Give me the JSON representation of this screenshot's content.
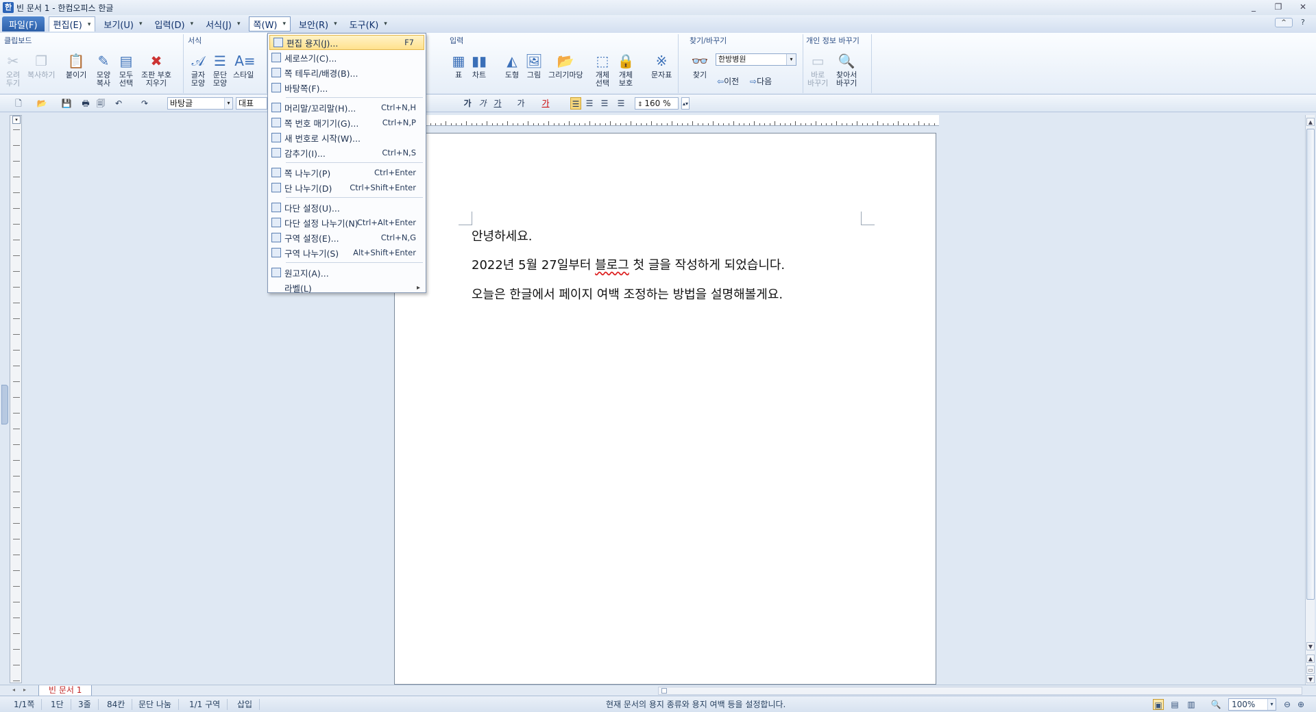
{
  "window": {
    "title": "빈 문서 1 - 한컴오피스 한글",
    "controls": [
      "_",
      "❐",
      "✕"
    ]
  },
  "menubar": {
    "items": [
      {
        "label": "파일(F)",
        "has_arrow": false
      },
      {
        "label": "편집(E)",
        "has_arrow": true
      },
      {
        "label": "보기(U)",
        "has_arrow": true
      },
      {
        "label": "입력(D)",
        "has_arrow": true
      },
      {
        "label": "서식(J)",
        "has_arrow": true
      },
      {
        "label": "쪽(W)",
        "has_arrow": true
      },
      {
        "label": "보안(R)",
        "has_arrow": true
      },
      {
        "label": "도구(K)",
        "has_arrow": true
      }
    ]
  },
  "ribbon": {
    "clipboard": {
      "title": "클립보드",
      "buttons": [
        {
          "label": "오려\n두기",
          "icon": "scissors-icon",
          "enabled": false
        },
        {
          "label": "복사하기",
          "icon": "copy-icon",
          "enabled": false
        },
        {
          "label": "붙이기",
          "icon": "paste-icon",
          "enabled": true
        },
        {
          "label": "모양\n복사",
          "icon": "format-painter-icon",
          "enabled": true
        },
        {
          "label": "모두\n선택",
          "icon": "select-all-icon",
          "enabled": true
        },
        {
          "label": "조판 부호\n지우기",
          "icon": "clear-codes-icon",
          "enabled": true
        }
      ]
    },
    "format": {
      "title": "서식",
      "buttons": [
        {
          "label": "글자\n모양",
          "icon": "char-shape-icon"
        },
        {
          "label": "문단\n모양",
          "icon": "para-shape-icon"
        },
        {
          "label": "스타일",
          "icon": "style-icon"
        }
      ]
    },
    "input": {
      "title": "입력",
      "buttons": [
        {
          "label": "표",
          "icon": "table-icon"
        },
        {
          "label": "차트",
          "icon": "chart-icon"
        },
        {
          "label": "도형",
          "icon": "shape-icon"
        },
        {
          "label": "그림",
          "icon": "picture-icon"
        },
        {
          "label": "그리기마당",
          "icon": "clipart-icon"
        },
        {
          "label": "개체\n선택",
          "icon": "object-select-icon"
        },
        {
          "label": "개체\n보호",
          "icon": "object-protect-icon"
        },
        {
          "label": "문자표",
          "icon": "symbol-icon"
        }
      ]
    },
    "find": {
      "title": "찾기/바꾸기",
      "find_label": "찾기",
      "search_value": "한방병원",
      "prev_label": "이전",
      "next_label": "다음"
    },
    "privacy": {
      "title": "개인 정보 바꾸기",
      "buttons": [
        {
          "label": "바로\n바꾸기",
          "icon": "quick-replace-icon",
          "enabled": false
        },
        {
          "label": "찾아서\n바꾸기",
          "icon": "find-replace-icon",
          "enabled": true
        }
      ]
    }
  },
  "toolbar": {
    "style_value": "바탕글",
    "rep_label": "대표",
    "zoom_value": "160",
    "zoom_unit": "%",
    "bold": "가",
    "italic": "가",
    "underline": "가",
    "font_color": "가",
    "highlight": "가"
  },
  "dropdown": {
    "items": [
      {
        "label": "편집 용지(J)...",
        "shortcut": "F7",
        "icon": "page-setup-icon",
        "highlighted": true
      },
      {
        "label": "세로쓰기(C)...",
        "shortcut": "",
        "icon": "vertical-writing-icon"
      },
      {
        "label": "쪽 테두리/배경(B)...",
        "shortcut": "",
        "icon": "page-border-icon"
      },
      {
        "label": "바탕쪽(F)...",
        "shortcut": "",
        "icon": "master-page-icon"
      },
      {
        "sep": true
      },
      {
        "label": "머리말/꼬리말(H)...",
        "shortcut": "Ctrl+N,H",
        "icon": "header-footer-icon"
      },
      {
        "label": "쪽 번호 매기기(G)...",
        "shortcut": "Ctrl+N,P",
        "icon": "page-number-icon"
      },
      {
        "label": "새 번호로 시작(W)...",
        "shortcut": "",
        "icon": "new-number-icon"
      },
      {
        "label": "감추기(I)...",
        "shortcut": "Ctrl+N,S",
        "icon": "hide-icon"
      },
      {
        "sep": true
      },
      {
        "label": "쪽 나누기(P)",
        "shortcut": "Ctrl+Enter",
        "icon": "page-break-icon"
      },
      {
        "label": "단 나누기(D)",
        "shortcut": "Ctrl+Shift+Enter",
        "icon": "column-break-icon"
      },
      {
        "sep": true
      },
      {
        "label": "다단 설정(U)...",
        "shortcut": "",
        "icon": "multi-column-icon"
      },
      {
        "label": "다단 설정 나누기(N)",
        "shortcut": "Ctrl+Alt+Enter",
        "icon": "multi-column-break-icon"
      },
      {
        "label": "구역 설정(E)...",
        "shortcut": "Ctrl+N,G",
        "icon": "section-setup-icon"
      },
      {
        "label": "구역 나누기(S)",
        "shortcut": "Alt+Shift+Enter",
        "icon": "section-break-icon"
      },
      {
        "sep": true
      },
      {
        "label": "원고지(A)...",
        "shortcut": "",
        "icon": "manuscript-icon"
      },
      {
        "label": "라벨(L)",
        "shortcut": "",
        "icon": "",
        "submenu": true
      }
    ]
  },
  "document": {
    "lines": [
      "안녕하세요.",
      "2022년 5월 27일부터 블로그 첫 글을 작성하게 되었습니다.",
      "오늘은 한글에서 페이지 여백 조정하는 방법을 설명해볼게요."
    ],
    "line2_pre": "2022년 5월 27일부터 ",
    "line2_squiggle": "블로그",
    "line2_post": " 첫 글을 작성하게 되었습니다."
  },
  "tabs": {
    "active_doc": "빈 문서 1"
  },
  "statusbar": {
    "page": "1/1쪽",
    "column": "1단",
    "line": "3줄",
    "col": "84칸",
    "para_split": "문단 나눔",
    "section": "1/1 구역",
    "mode": "삽입",
    "message": "현재 문서의 용지 종류와 용지 여백 등을 설정합니다.",
    "zoom": "100%"
  }
}
